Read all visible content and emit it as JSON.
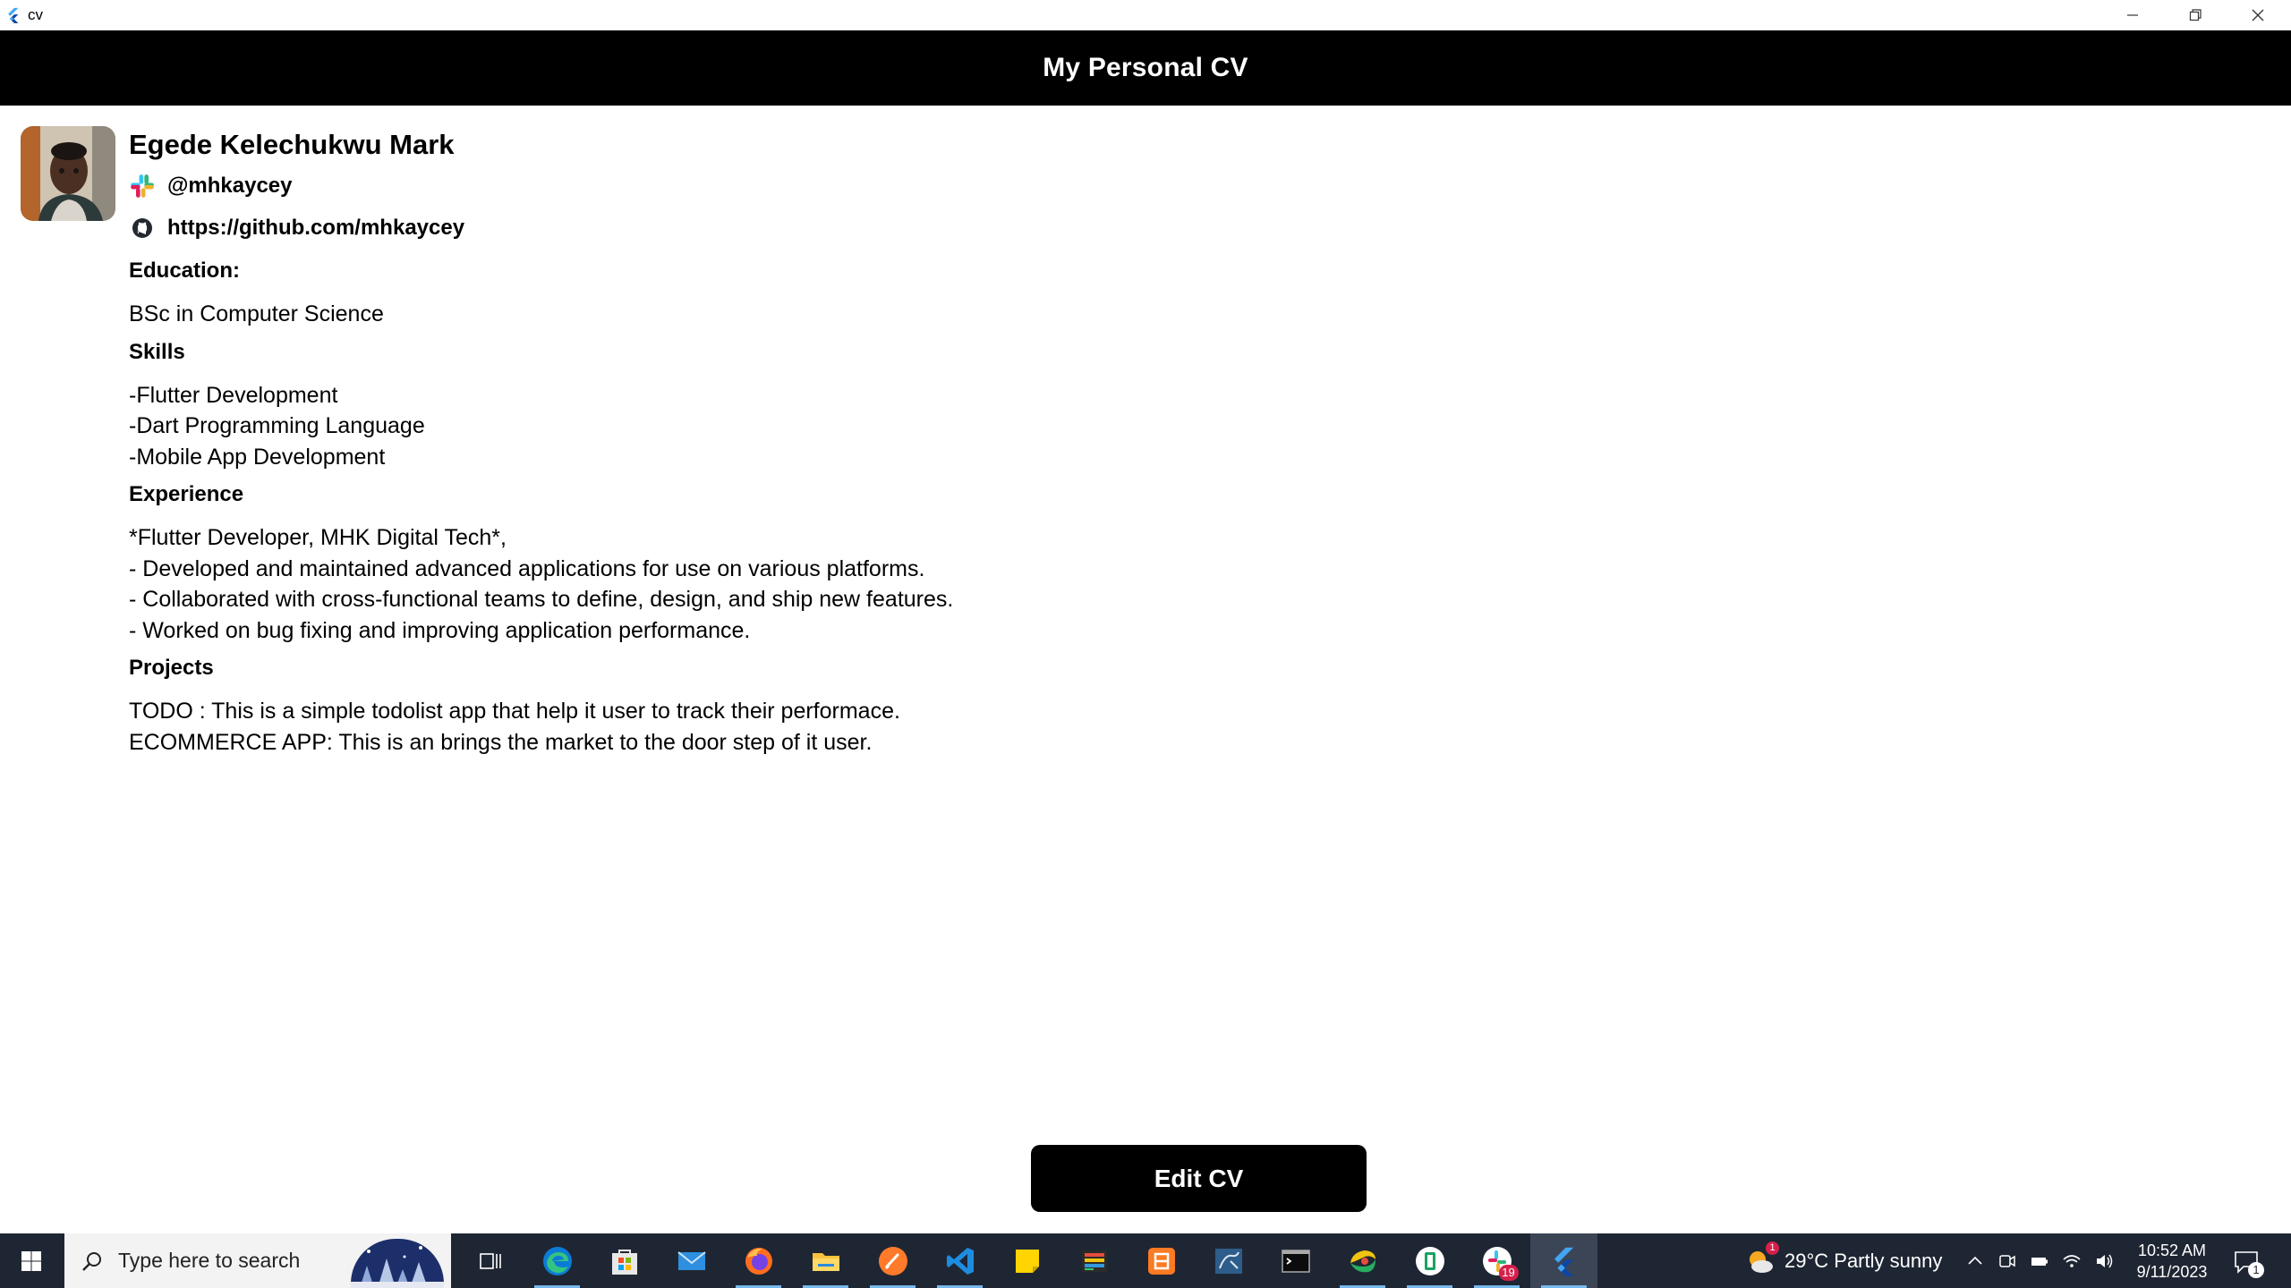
{
  "window": {
    "title": "cv"
  },
  "appbar": {
    "title": "My Personal CV"
  },
  "profile": {
    "name": "Egede Kelechukwu Mark",
    "slack_handle": "@mhkaycey",
    "github_url": "https://github.com/mhkaycey"
  },
  "sections": {
    "education": {
      "heading": "Education:",
      "lines": [
        "BSc in Computer Science"
      ]
    },
    "skills": {
      "heading": "Skills",
      "lines": [
        "-Flutter Development",
        "-Dart Programming Language",
        "-Mobile App Development"
      ]
    },
    "experience": {
      "heading": "Experience",
      "lines": [
        "*Flutter Developer, MHK Digital Tech*,",
        "- Developed and maintained advanced applications for use on various platforms.",
        "- Collaborated with cross-functional teams to define, design, and ship new features.",
        "- Worked on bug fixing and improving application performance."
      ]
    },
    "projects": {
      "heading": "Projects",
      "lines": [
        "TODO : This is a simple todolist app that help it user to track their performace.",
        "ECOMMERCE APP: This is an brings the market to the door step of it user."
      ]
    }
  },
  "actions": {
    "edit_label": "Edit CV"
  },
  "taskbar": {
    "search_placeholder": "Type here to search",
    "apps": [
      {
        "icon": "task-view-icon",
        "running": false
      },
      {
        "icon": "edge-icon",
        "running": true
      },
      {
        "icon": "microsoft-store-icon",
        "running": false
      },
      {
        "icon": "mail-icon",
        "running": false
      },
      {
        "icon": "firefox-icon",
        "running": true
      },
      {
        "icon": "file-explorer-icon",
        "running": true
      },
      {
        "icon": "sublime-text-icon",
        "running": true
      },
      {
        "icon": "vscode-icon",
        "running": true
      },
      {
        "icon": "sticky-notes-icon",
        "running": false
      },
      {
        "icon": "gallery-app-icon",
        "running": false
      },
      {
        "icon": "xampp-icon",
        "running": false
      },
      {
        "icon": "mysql-workbench-icon",
        "running": false
      },
      {
        "icon": "terminal-icon",
        "running": false
      },
      {
        "icon": "chrome-canary-icon",
        "running": true
      },
      {
        "icon": "green-app-icon",
        "running": true
      },
      {
        "icon": "slack-icon",
        "running": true
      },
      {
        "icon": "flutter-icon",
        "running": true
      }
    ],
    "slack_badge": "19",
    "weather": {
      "text": "29°C  Partly sunny",
      "badge": "1"
    },
    "clock": {
      "time": "10:52 AM",
      "date": "9/11/2023"
    },
    "notification_count": "1"
  },
  "colors": {
    "appbar_bg": "#000000",
    "button_bg": "#000000",
    "taskbar_bg": "#1f2633",
    "flutter_blue": "#42a5f5",
    "running_indicator": "#76b9ed"
  }
}
